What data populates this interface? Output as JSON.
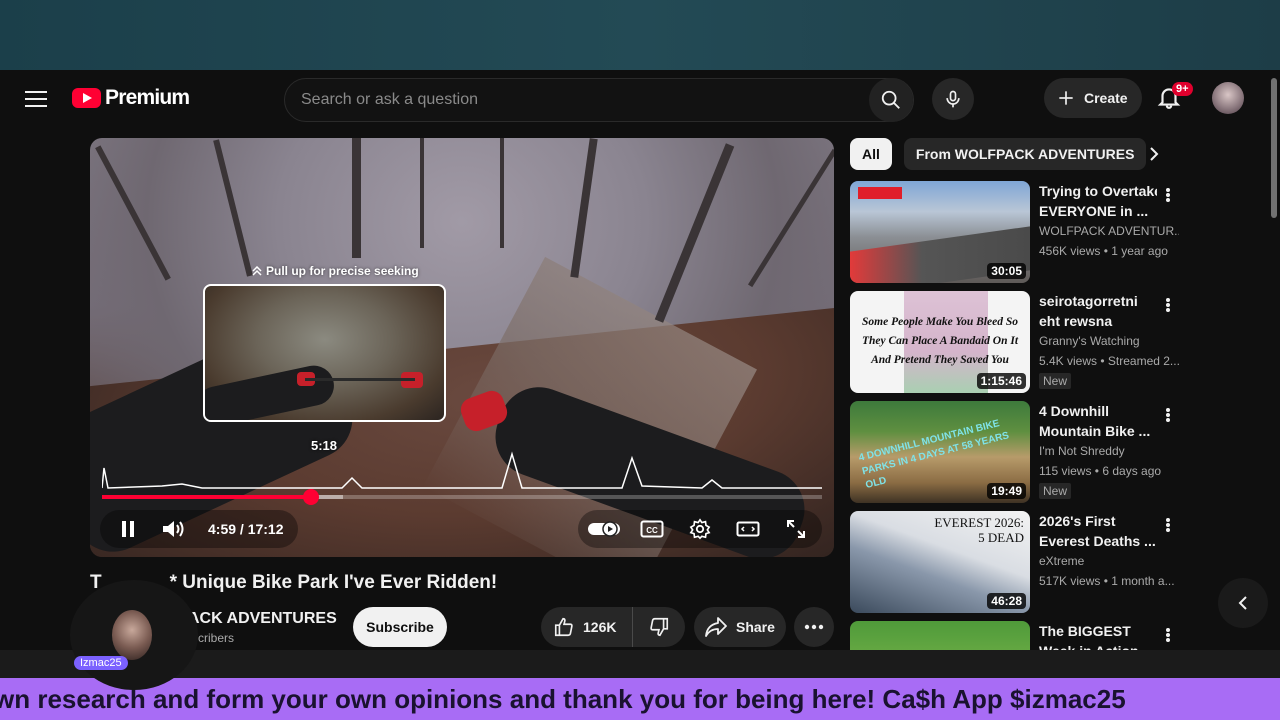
{
  "header": {
    "logo_text": "Premium",
    "search_placeholder": "Search or ask a question",
    "create_label": "Create",
    "notifications_badge": "9+"
  },
  "player": {
    "seek_hint": "Pull up for precise seeking",
    "preview_time": "5:18",
    "time_display": "4:59 / 17:12",
    "progress_fraction": 0.29,
    "buffer_fraction": 0.335
  },
  "video": {
    "title_visible": "T",
    "title_rest": "* Unique Bike Park I've Ever Ridden!",
    "channel_name": "ACK ADVENTURES",
    "subscribers": "cribers",
    "subscribe_label": "Subscribe",
    "likes": "126K",
    "share_label": "Share"
  },
  "sidebar": {
    "chips": [
      "All",
      "From WOLFPACK ADVENTURES"
    ],
    "recommendations": [
      {
        "title1": "Trying to Overtake",
        "title2": "EVERYONE in ...",
        "channel": "WOLFPACK ADVENTUR...",
        "stats": "456K views • 1 year ago",
        "badge": "",
        "duration": "30:05",
        "thumb_text": ""
      },
      {
        "title1": "seirotagorretni",
        "title2": "eht rewsna",
        "channel": "Granny's Watching",
        "stats": "5.4K views • Streamed 2...",
        "badge": "New",
        "duration": "1:15:46",
        "thumb_text": "Some People Make You Bleed So They Can Place A Bandaid On It And Pretend They Saved You"
      },
      {
        "title1": "4 Downhill",
        "title2": "Mountain Bike ...",
        "channel": "I'm Not Shreddy",
        "stats": "115 views • 6 days ago",
        "badge": "New",
        "duration": "19:49",
        "thumb_text": "4 DOWNHILL MOUNTAIN BIKE PARKS IN 4 DAYS AT 58 YEARS OLD"
      },
      {
        "title1": "2026's First",
        "title2": "Everest Deaths ...",
        "channel": "eXtreme",
        "stats": "517K views • 1 month a...",
        "badge": "",
        "duration": "46:28",
        "thumb_text": "EVEREST 2026: 5 DEAD"
      },
      {
        "title1": "The BIGGEST",
        "title2": "Week in Action",
        "channel": "",
        "stats": "",
        "badge": "",
        "duration": "",
        "thumb_text": ""
      }
    ]
  },
  "overlay": {
    "streamer_name": "Izmac25",
    "ticker": "wn research and form your own opinions and thank you for being here! Ca$h App $izmac25"
  },
  "colors": {
    "accent": "#ff0033",
    "ticker_band": "#a86cf5",
    "background": "#0f0f0f"
  }
}
